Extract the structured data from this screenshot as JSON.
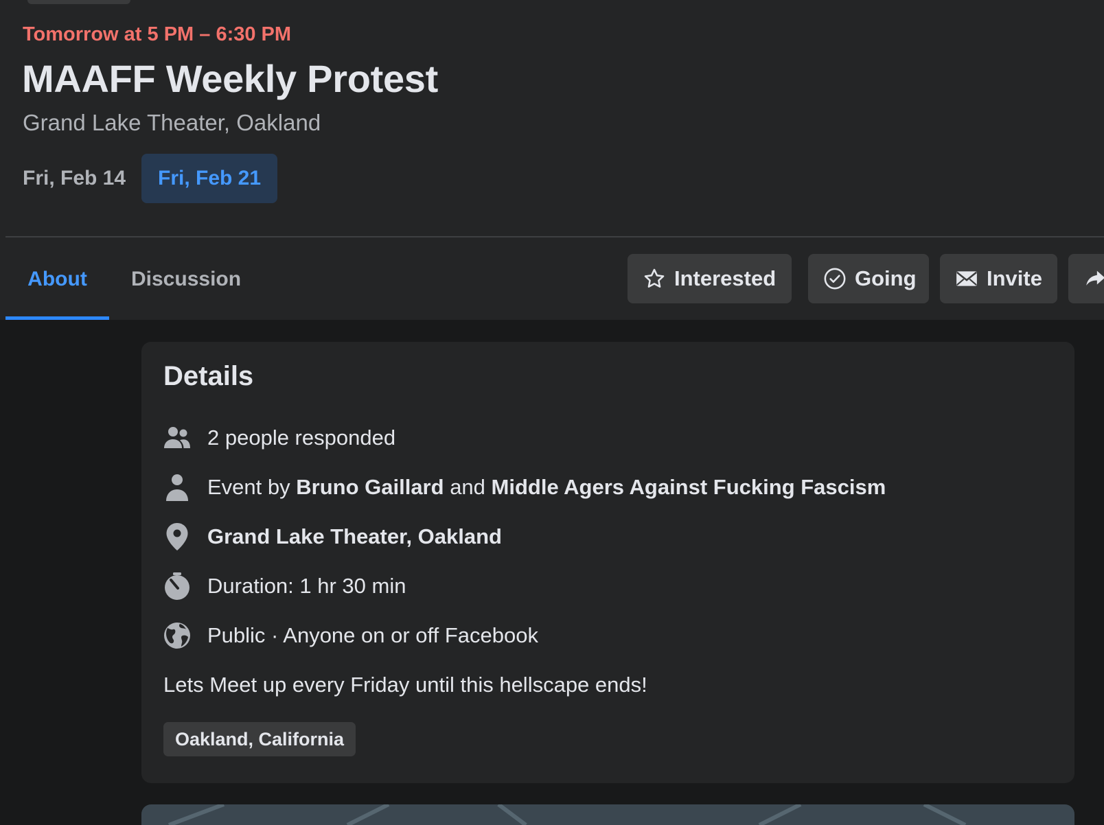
{
  "event": {
    "time": "Tomorrow at 5 PM – 6:30 PM",
    "title": "MAAFF Weekly Protest",
    "location": "Grand Lake Theater, Oakland"
  },
  "dates": [
    "Fri, Feb 14",
    "Fri, Feb 21"
  ],
  "tabs": {
    "about": "About",
    "discussion": "Discussion"
  },
  "actions": {
    "interested": "Interested",
    "going": "Going",
    "invite": "Invite"
  },
  "details": {
    "heading": "Details",
    "responded": "2 people responded",
    "event_by_prefix": "Event by",
    "host_1": "Bruno Gaillard",
    "and_word": "and",
    "host_2": "Middle Agers Against Fucking Fascism",
    "place": "Grand Lake Theater, Oakland",
    "duration": "Duration: 1 hr 30 min",
    "privacy": "Public · Anyone on or off Facebook",
    "description": "Lets Meet up every Friday until this hellscape ends!",
    "tag": "Oakland, California"
  },
  "icons": {
    "interested": "star-icon",
    "going": "check-circle-icon",
    "invite": "envelope-icon",
    "share": "share-icon",
    "responded": "people-icon",
    "host": "person-icon",
    "place": "location-pin-icon",
    "duration": "stopwatch-icon",
    "privacy": "globe-icon"
  },
  "colors": {
    "page_bg": "#18191a",
    "surface": "#242526",
    "button_bg": "#3a3b3c",
    "accent": "#2d88ff",
    "accent_text": "#4599ff",
    "time_red": "#f3726b",
    "primary_text": "#e4e6eb",
    "secondary_text": "#b0b3b8"
  }
}
